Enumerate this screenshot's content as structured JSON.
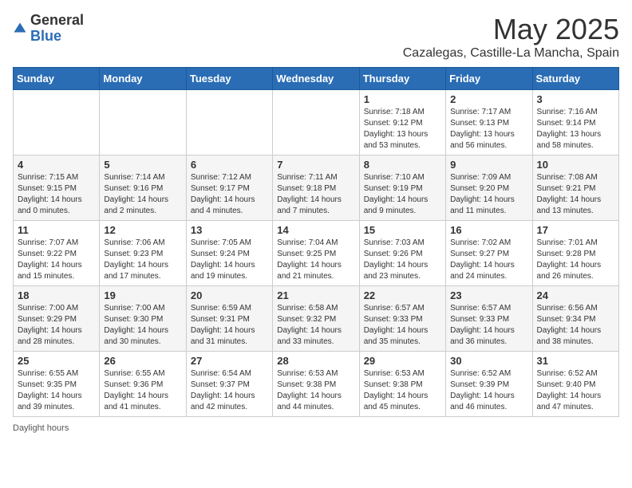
{
  "header": {
    "logo_general": "General",
    "logo_blue": "Blue",
    "month_title": "May 2025",
    "subtitle": "Cazalegas, Castille-La Mancha, Spain"
  },
  "days_of_week": [
    "Sunday",
    "Monday",
    "Tuesday",
    "Wednesday",
    "Thursday",
    "Friday",
    "Saturday"
  ],
  "weeks": [
    [
      {
        "day": "",
        "info": ""
      },
      {
        "day": "",
        "info": ""
      },
      {
        "day": "",
        "info": ""
      },
      {
        "day": "",
        "info": ""
      },
      {
        "day": "1",
        "info": "Sunrise: 7:18 AM\nSunset: 9:12 PM\nDaylight: 13 hours\nand 53 minutes."
      },
      {
        "day": "2",
        "info": "Sunrise: 7:17 AM\nSunset: 9:13 PM\nDaylight: 13 hours\nand 56 minutes."
      },
      {
        "day": "3",
        "info": "Sunrise: 7:16 AM\nSunset: 9:14 PM\nDaylight: 13 hours\nand 58 minutes."
      }
    ],
    [
      {
        "day": "4",
        "info": "Sunrise: 7:15 AM\nSunset: 9:15 PM\nDaylight: 14 hours\nand 0 minutes."
      },
      {
        "day": "5",
        "info": "Sunrise: 7:14 AM\nSunset: 9:16 PM\nDaylight: 14 hours\nand 2 minutes."
      },
      {
        "day": "6",
        "info": "Sunrise: 7:12 AM\nSunset: 9:17 PM\nDaylight: 14 hours\nand 4 minutes."
      },
      {
        "day": "7",
        "info": "Sunrise: 7:11 AM\nSunset: 9:18 PM\nDaylight: 14 hours\nand 7 minutes."
      },
      {
        "day": "8",
        "info": "Sunrise: 7:10 AM\nSunset: 9:19 PM\nDaylight: 14 hours\nand 9 minutes."
      },
      {
        "day": "9",
        "info": "Sunrise: 7:09 AM\nSunset: 9:20 PM\nDaylight: 14 hours\nand 11 minutes."
      },
      {
        "day": "10",
        "info": "Sunrise: 7:08 AM\nSunset: 9:21 PM\nDaylight: 14 hours\nand 13 minutes."
      }
    ],
    [
      {
        "day": "11",
        "info": "Sunrise: 7:07 AM\nSunset: 9:22 PM\nDaylight: 14 hours\nand 15 minutes."
      },
      {
        "day": "12",
        "info": "Sunrise: 7:06 AM\nSunset: 9:23 PM\nDaylight: 14 hours\nand 17 minutes."
      },
      {
        "day": "13",
        "info": "Sunrise: 7:05 AM\nSunset: 9:24 PM\nDaylight: 14 hours\nand 19 minutes."
      },
      {
        "day": "14",
        "info": "Sunrise: 7:04 AM\nSunset: 9:25 PM\nDaylight: 14 hours\nand 21 minutes."
      },
      {
        "day": "15",
        "info": "Sunrise: 7:03 AM\nSunset: 9:26 PM\nDaylight: 14 hours\nand 23 minutes."
      },
      {
        "day": "16",
        "info": "Sunrise: 7:02 AM\nSunset: 9:27 PM\nDaylight: 14 hours\nand 24 minutes."
      },
      {
        "day": "17",
        "info": "Sunrise: 7:01 AM\nSunset: 9:28 PM\nDaylight: 14 hours\nand 26 minutes."
      }
    ],
    [
      {
        "day": "18",
        "info": "Sunrise: 7:00 AM\nSunset: 9:29 PM\nDaylight: 14 hours\nand 28 minutes."
      },
      {
        "day": "19",
        "info": "Sunrise: 7:00 AM\nSunset: 9:30 PM\nDaylight: 14 hours\nand 30 minutes."
      },
      {
        "day": "20",
        "info": "Sunrise: 6:59 AM\nSunset: 9:31 PM\nDaylight: 14 hours\nand 31 minutes."
      },
      {
        "day": "21",
        "info": "Sunrise: 6:58 AM\nSunset: 9:32 PM\nDaylight: 14 hours\nand 33 minutes."
      },
      {
        "day": "22",
        "info": "Sunrise: 6:57 AM\nSunset: 9:33 PM\nDaylight: 14 hours\nand 35 minutes."
      },
      {
        "day": "23",
        "info": "Sunrise: 6:57 AM\nSunset: 9:33 PM\nDaylight: 14 hours\nand 36 minutes."
      },
      {
        "day": "24",
        "info": "Sunrise: 6:56 AM\nSunset: 9:34 PM\nDaylight: 14 hours\nand 38 minutes."
      }
    ],
    [
      {
        "day": "25",
        "info": "Sunrise: 6:55 AM\nSunset: 9:35 PM\nDaylight: 14 hours\nand 39 minutes."
      },
      {
        "day": "26",
        "info": "Sunrise: 6:55 AM\nSunset: 9:36 PM\nDaylight: 14 hours\nand 41 minutes."
      },
      {
        "day": "27",
        "info": "Sunrise: 6:54 AM\nSunset: 9:37 PM\nDaylight: 14 hours\nand 42 minutes."
      },
      {
        "day": "28",
        "info": "Sunrise: 6:53 AM\nSunset: 9:38 PM\nDaylight: 14 hours\nand 44 minutes."
      },
      {
        "day": "29",
        "info": "Sunrise: 6:53 AM\nSunset: 9:38 PM\nDaylight: 14 hours\nand 45 minutes."
      },
      {
        "day": "30",
        "info": "Sunrise: 6:52 AM\nSunset: 9:39 PM\nDaylight: 14 hours\nand 46 minutes."
      },
      {
        "day": "31",
        "info": "Sunrise: 6:52 AM\nSunset: 9:40 PM\nDaylight: 14 hours\nand 47 minutes."
      }
    ]
  ],
  "footer": {
    "daylight_label": "Daylight hours"
  }
}
